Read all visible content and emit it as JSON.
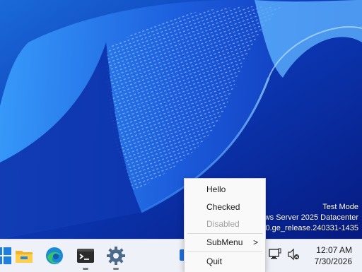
{
  "watermark": {
    "line1": "Test Mode",
    "line2": "ws Server 2025 Datacenter",
    "line3": "00.ge_release.240331-1435"
  },
  "context_menu": {
    "items": [
      {
        "label": "Hello",
        "enabled": true
      },
      {
        "label": "Checked",
        "enabled": true
      },
      {
        "label": "Disabled",
        "enabled": false
      },
      {
        "label": "SubMenu",
        "enabled": true,
        "has_submenu": true,
        "arrow": ">"
      },
      {
        "label": "Quit",
        "enabled": true
      }
    ]
  },
  "taskbar": {
    "pinned": [
      {
        "icon": "windows-start-icon"
      },
      {
        "icon": "file-explorer-icon"
      },
      {
        "icon": "edge-browser-icon"
      },
      {
        "icon": "terminal-icon",
        "running": true
      },
      {
        "icon": "settings-gear-icon",
        "running": true
      }
    ],
    "tray": [
      {
        "icon": "network-icon"
      },
      {
        "icon": "speaker-muted-icon"
      }
    ],
    "clock": {
      "time": "12:07 AM",
      "date": "7/30/2026"
    }
  },
  "colors": {
    "desktop_bg": "#0a2a9a",
    "taskbar_bg": "#eef1f7",
    "menu_bg": "#f9f9f9",
    "disabled_text": "#a0a0a0"
  }
}
